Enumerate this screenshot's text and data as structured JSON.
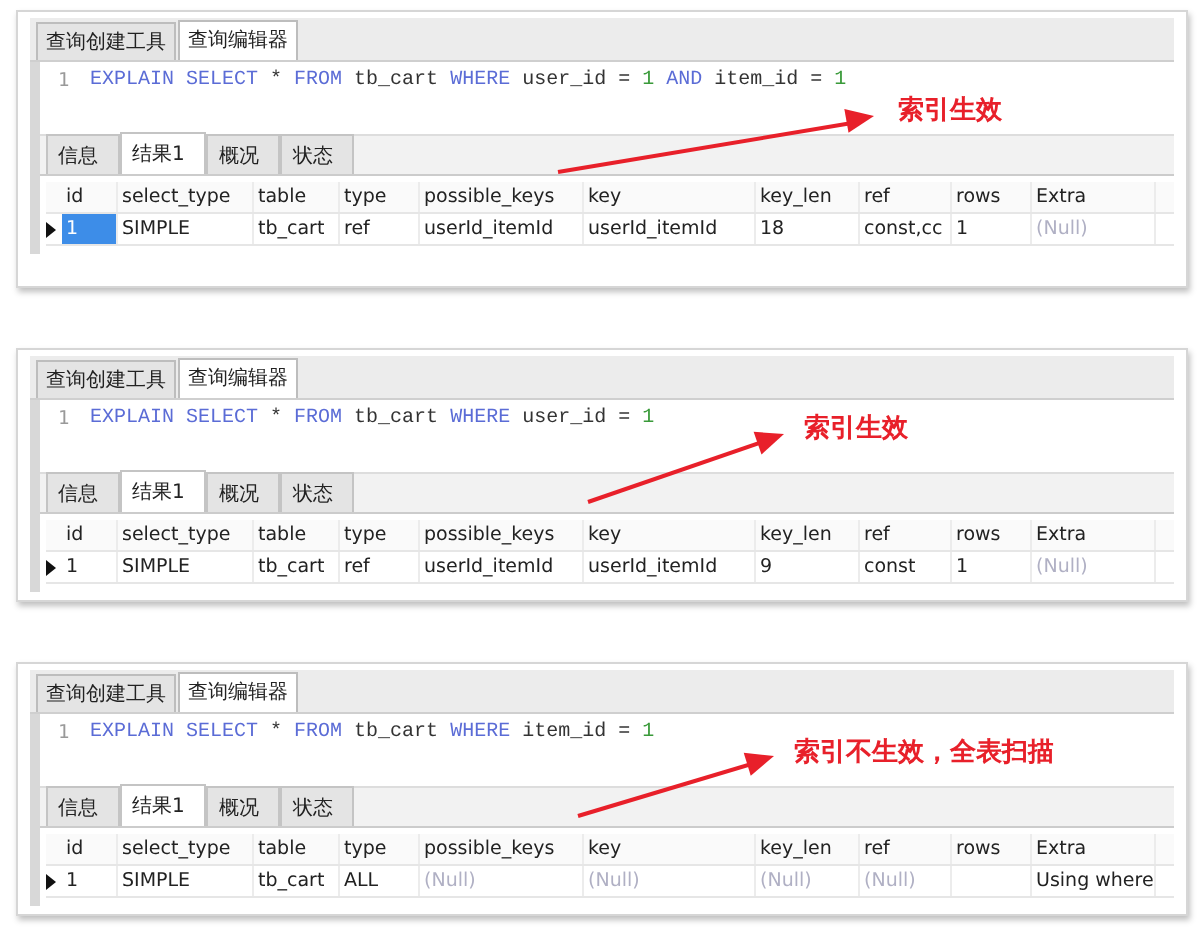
{
  "panels": [
    {
      "tabs": [
        {
          "label": "查询创建工具",
          "selected": false
        },
        {
          "label": "查询编辑器",
          "selected": true
        }
      ],
      "editor": {
        "line_number": "1",
        "tokens": [
          {
            "text": "EXPLAIN SELECT",
            "kind": "keyword"
          },
          {
            "text": " * ",
            "kind": "plain"
          },
          {
            "text": "FROM",
            "kind": "keyword"
          },
          {
            "text": " tb_cart ",
            "kind": "plain"
          },
          {
            "text": "WHERE",
            "kind": "keyword"
          },
          {
            "text": " user_id = ",
            "kind": "plain"
          },
          {
            "text": "1",
            "kind": "number"
          },
          {
            "text": " AND",
            "kind": "keyword"
          },
          {
            "text": " item_id = ",
            "kind": "plain"
          },
          {
            "text": "1",
            "kind": "number"
          }
        ]
      },
      "annotation": "索引生效",
      "result_tabs": [
        {
          "label": "信息",
          "selected": false
        },
        {
          "label": "结果1",
          "selected": true
        },
        {
          "label": "概况",
          "selected": false
        },
        {
          "label": "状态",
          "selected": false
        }
      ],
      "table": {
        "columns": [
          "id",
          "select_type",
          "table",
          "type",
          "possible_keys",
          "key",
          "key_len",
          "ref",
          "rows",
          "Extra"
        ],
        "rows": [
          {
            "current": true,
            "cells": [
              {
                "text": "1",
                "kind": "value",
                "selected": true
              },
              {
                "text": "SIMPLE",
                "kind": "value",
                "selected": false
              },
              {
                "text": "tb_cart",
                "kind": "value",
                "selected": false
              },
              {
                "text": "ref",
                "kind": "value",
                "selected": false
              },
              {
                "text": "userId_itemId",
                "kind": "value",
                "selected": false
              },
              {
                "text": "userId_itemId",
                "kind": "value",
                "selected": false
              },
              {
                "text": "18",
                "kind": "value",
                "selected": false
              },
              {
                "text": "const,cc",
                "kind": "value",
                "selected": false
              },
              {
                "text": "1",
                "kind": "value",
                "selected": false
              },
              {
                "text": "(Null)",
                "kind": "null",
                "selected": false
              }
            ]
          }
        ]
      }
    },
    {
      "tabs": [
        {
          "label": "查询创建工具",
          "selected": false
        },
        {
          "label": "查询编辑器",
          "selected": true
        }
      ],
      "editor": {
        "line_number": "1",
        "tokens": [
          {
            "text": "EXPLAIN SELECT",
            "kind": "keyword"
          },
          {
            "text": " * ",
            "kind": "plain"
          },
          {
            "text": "FROM",
            "kind": "keyword"
          },
          {
            "text": " tb_cart ",
            "kind": "plain"
          },
          {
            "text": "WHERE",
            "kind": "keyword"
          },
          {
            "text": " user_id = ",
            "kind": "plain"
          },
          {
            "text": "1",
            "kind": "number"
          }
        ]
      },
      "annotation": "索引生效",
      "result_tabs": [
        {
          "label": "信息",
          "selected": false
        },
        {
          "label": "结果1",
          "selected": true
        },
        {
          "label": "概况",
          "selected": false
        },
        {
          "label": "状态",
          "selected": false
        }
      ],
      "table": {
        "columns": [
          "id",
          "select_type",
          "table",
          "type",
          "possible_keys",
          "key",
          "key_len",
          "ref",
          "rows",
          "Extra"
        ],
        "rows": [
          {
            "current": true,
            "cells": [
              {
                "text": "1",
                "kind": "value",
                "selected": false
              },
              {
                "text": "SIMPLE",
                "kind": "value",
                "selected": false
              },
              {
                "text": "tb_cart",
                "kind": "value",
                "selected": false
              },
              {
                "text": "ref",
                "kind": "value",
                "selected": false
              },
              {
                "text": "userId_itemId",
                "kind": "value",
                "selected": false
              },
              {
                "text": "userId_itemId",
                "kind": "value",
                "selected": false
              },
              {
                "text": "9",
                "kind": "value",
                "selected": false
              },
              {
                "text": "const",
                "kind": "value",
                "selected": false
              },
              {
                "text": "1",
                "kind": "value",
                "selected": false
              },
              {
                "text": "(Null)",
                "kind": "null",
                "selected": false
              }
            ]
          }
        ]
      }
    },
    {
      "tabs": [
        {
          "label": "查询创建工具",
          "selected": false
        },
        {
          "label": "查询编辑器",
          "selected": true
        }
      ],
      "editor": {
        "line_number": "1",
        "tokens": [
          {
            "text": "EXPLAIN SELECT",
            "kind": "keyword"
          },
          {
            "text": " * ",
            "kind": "plain"
          },
          {
            "text": "FROM",
            "kind": "keyword"
          },
          {
            "text": " tb_cart ",
            "kind": "plain"
          },
          {
            "text": "WHERE",
            "kind": "keyword"
          },
          {
            "text": " item_id = ",
            "kind": "plain"
          },
          {
            "text": "1",
            "kind": "number"
          }
        ]
      },
      "annotation": "索引不生效，全表扫描",
      "result_tabs": [
        {
          "label": "信息",
          "selected": false
        },
        {
          "label": "结果1",
          "selected": true
        },
        {
          "label": "概况",
          "selected": false
        },
        {
          "label": "状态",
          "selected": false
        }
      ],
      "table": {
        "columns": [
          "id",
          "select_type",
          "table",
          "type",
          "possible_keys",
          "key",
          "key_len",
          "ref",
          "rows",
          "Extra"
        ],
        "rows": [
          {
            "current": true,
            "cells": [
              {
                "text": "1",
                "kind": "value",
                "selected": false
              },
              {
                "text": "SIMPLE",
                "kind": "value",
                "selected": false
              },
              {
                "text": "tb_cart",
                "kind": "value",
                "selected": false
              },
              {
                "text": "ALL",
                "kind": "value",
                "selected": false
              },
              {
                "text": "(Null)",
                "kind": "null",
                "selected": false
              },
              {
                "text": "(Null)",
                "kind": "null",
                "selected": false
              },
              {
                "text": "(Null)",
                "kind": "null",
                "selected": false
              },
              {
                "text": "(Null)",
                "kind": "null",
                "selected": false
              },
              {
                "kind": "value",
                "selected": false
              },
              {
                "text": "Using where",
                "kind": "value",
                "selected": false
              }
            ]
          }
        ]
      }
    }
  ]
}
